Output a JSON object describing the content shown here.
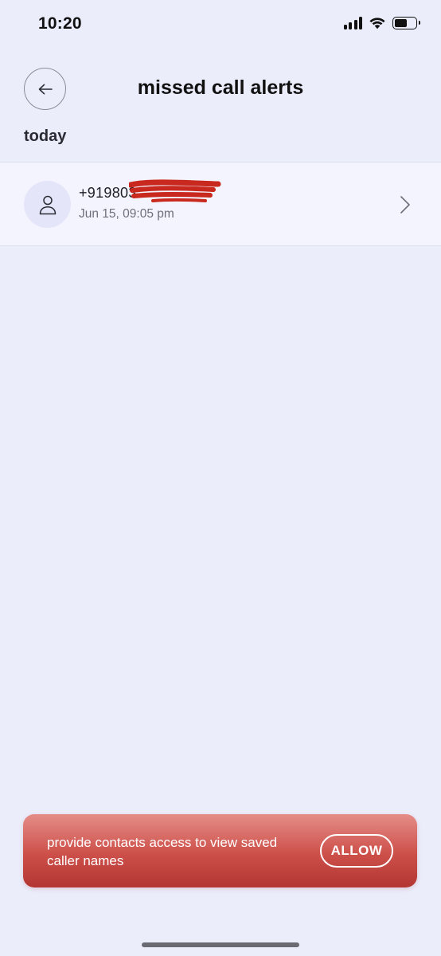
{
  "status_bar": {
    "time": "10:20",
    "signal_bars": 4,
    "wifi": true,
    "battery_level": 0.6
  },
  "header": {
    "back_icon": "arrow-left-icon",
    "title": "missed call alerts"
  },
  "section": {
    "label": "today"
  },
  "calls": [
    {
      "number": "+919803",
      "number_redacted": true,
      "time": "Jun 15, 09:05 pm",
      "avatar_icon": "person-icon",
      "chevron_icon": "chevron-right-icon"
    }
  ],
  "banner": {
    "text": "provide contacts access to view saved caller names",
    "button_label": "ALLOW"
  },
  "colors": {
    "background": "#ebedfb",
    "list_row": "#f3f4fe",
    "banner_top": "#e58d88",
    "banner_bottom": "#b33633",
    "redaction": "#c8281e"
  }
}
